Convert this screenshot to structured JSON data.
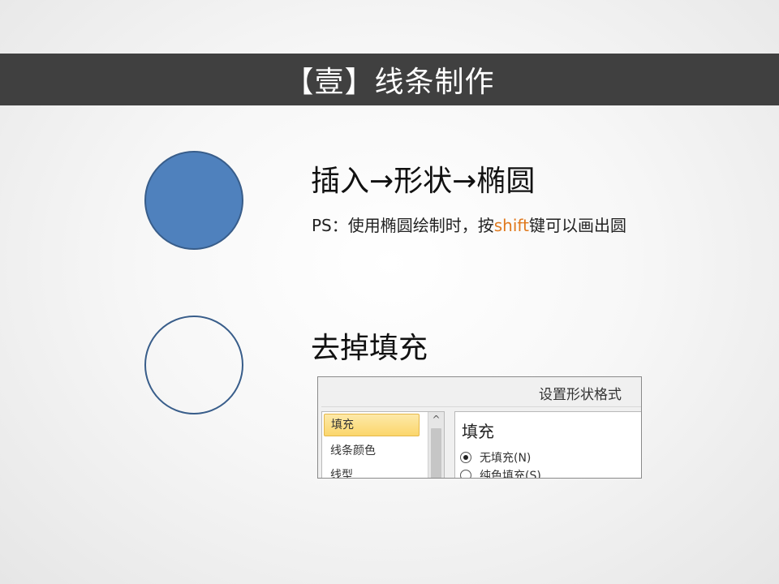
{
  "title_bar": {
    "title": "【壹】线条制作"
  },
  "shapes": {
    "filled_circle": {
      "fill": "#4f81bd",
      "stroke": "#385d8a"
    },
    "outline_circle": {
      "fill": "none",
      "stroke": "#385d8a"
    }
  },
  "section_1": {
    "heading": "插入→形状→椭圆",
    "note_prefix": "PS：使用椭圆绘制时，按",
    "note_key": "shift",
    "note_suffix": "键可以画出圆",
    "note_key_color": "#e07a1f"
  },
  "section_2": {
    "heading": "去掉填充"
  },
  "dialog": {
    "title": "设置形状格式",
    "list_items": [
      "填充",
      "线条颜色",
      "线型"
    ],
    "selected_index": 0,
    "scroll_up_glyph": "^",
    "panel_heading": "填充",
    "options": [
      {
        "label": "无填充(N)",
        "checked": true
      },
      {
        "label": "纯色填充(S)",
        "checked": false
      }
    ]
  }
}
